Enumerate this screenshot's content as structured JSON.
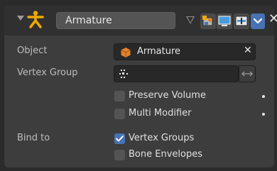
{
  "header": {
    "name_value": "Armature",
    "close_glyph": "✕"
  },
  "object": {
    "label": "Object",
    "value": "Armature",
    "clear_glyph": "✕"
  },
  "vertex_group": {
    "label": "Vertex Group",
    "value": ""
  },
  "options": {
    "preserve_volume": {
      "label": "Preserve Volume",
      "checked": false
    },
    "multi_modifier": {
      "label": "Multi Modifier",
      "checked": false
    }
  },
  "bind_to": {
    "label": "Bind to",
    "vertex_groups": {
      "label": "Vertex Groups",
      "checked": true
    },
    "bone_envelopes": {
      "label": "Bone Envelopes",
      "checked": false
    }
  },
  "colors": {
    "accent": "#4772b3",
    "modifier_icon": "#f0a800",
    "object_icon": "#e6822a"
  },
  "icons": [
    "collapse-triangle-icon",
    "armature-modifier-icon",
    "vertex-triangle-icon",
    "editmode-icon",
    "viewport-display-icon",
    "render-icon",
    "chevron-down-icon",
    "close-icon",
    "grip-icon",
    "object-data-icon",
    "vertex-group-icon",
    "invert-arrows-icon"
  ]
}
